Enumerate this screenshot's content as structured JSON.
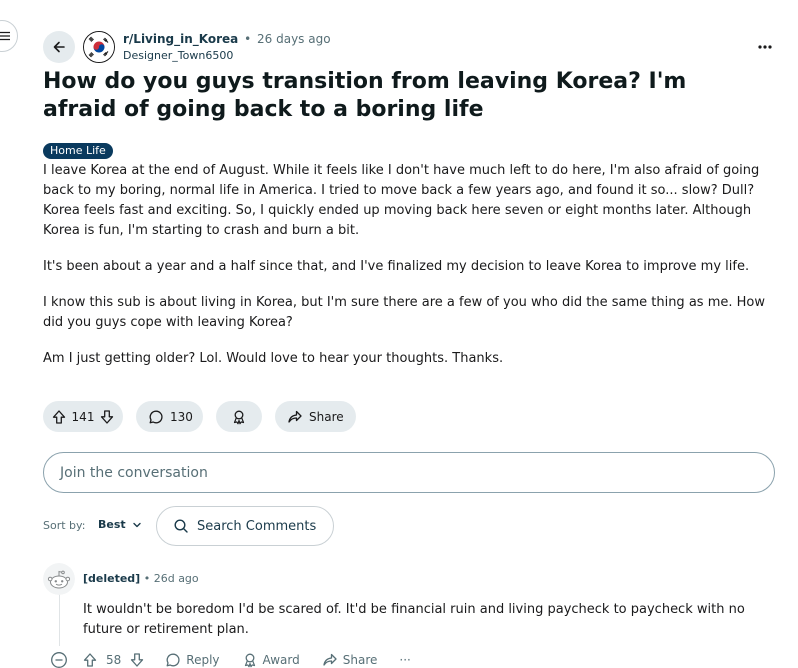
{
  "post": {
    "subreddit": "r/Living_in_Korea",
    "separator": "•",
    "time_ago": "26 days ago",
    "author": "Designer_Town6500",
    "title": "How do you guys transition from leaving Korea? I'm afraid of going back to a boring life",
    "flair": "Home Life",
    "paragraphs": [
      "I leave Korea at the end of August. While it feels like I don't have much left to do here, I'm also afraid of going back to my boring, normal life in America. I tried to move back a few years ago, and found it so... slow? Dull? Korea feels fast and exciting. So, I quickly ended up moving back here seven or eight months later. Although Korea is fun, I'm starting to crash and burn a bit.",
      "It's been about a year and a half since that, and I've finalized my decision to leave Korea to improve my life.",
      "I know this sub is about living in Korea, but I'm sure there are a few of you who did the same thing as me. How did you guys cope with leaving Korea?",
      "Am I just getting older? Lol. Would love to hear your thoughts. Thanks."
    ],
    "score": "141",
    "comment_count": "130",
    "share_label": "Share"
  },
  "composer": {
    "placeholder": "Join the conversation"
  },
  "sort": {
    "label": "Sort by:",
    "value": "Best",
    "search_placeholder": "Search Comments"
  },
  "comments": [
    {
      "author": "[deleted]",
      "separator": "•",
      "time_ago": "26d ago",
      "text": "It wouldn't be boredom I'd be scared of. It'd be financial ruin and living paycheck to paycheck with no future or retirement plan.",
      "score": "58",
      "reply_label": "Reply",
      "award_label": "Award",
      "share_label": "Share",
      "more_label": "···"
    }
  ],
  "icons": {
    "sidebar_toggle": "hamburger-icon",
    "back": "arrow-left-icon",
    "more": "more-horizontal-icon",
    "upvote": "arrow-up-icon",
    "downvote": "arrow-down-icon",
    "comment": "comment-bubble-icon",
    "award": "award-icon",
    "share": "share-arrow-icon",
    "search": "search-icon",
    "chevron": "chevron-down-icon",
    "collapse": "minus-circle-icon"
  },
  "colors": {
    "pill_background": "#e5ebee",
    "flair_background": "#0a3a5e",
    "accent_text": "#1a3a4a",
    "muted_text": "#576f76"
  }
}
